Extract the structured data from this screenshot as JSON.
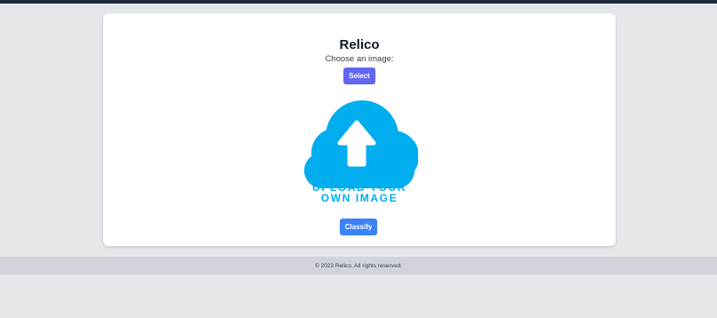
{
  "app": {
    "title": "Relico"
  },
  "form": {
    "choose_label": "Choose an image:",
    "select_button": "Select",
    "classify_button": "Classify"
  },
  "upload_graphic": {
    "icon": "cloud-upload-icon",
    "line1": "UPLOAD YOUR",
    "line2": "OWN IMAGE",
    "color": "#00aeef"
  },
  "footer": {
    "text": "© 2023 Relico. All rights reserved."
  },
  "colors": {
    "select_button": "#6366f1",
    "classify_button": "#3b82f6",
    "background": "#e5e7eb",
    "footer_bg": "#d1d5db"
  }
}
